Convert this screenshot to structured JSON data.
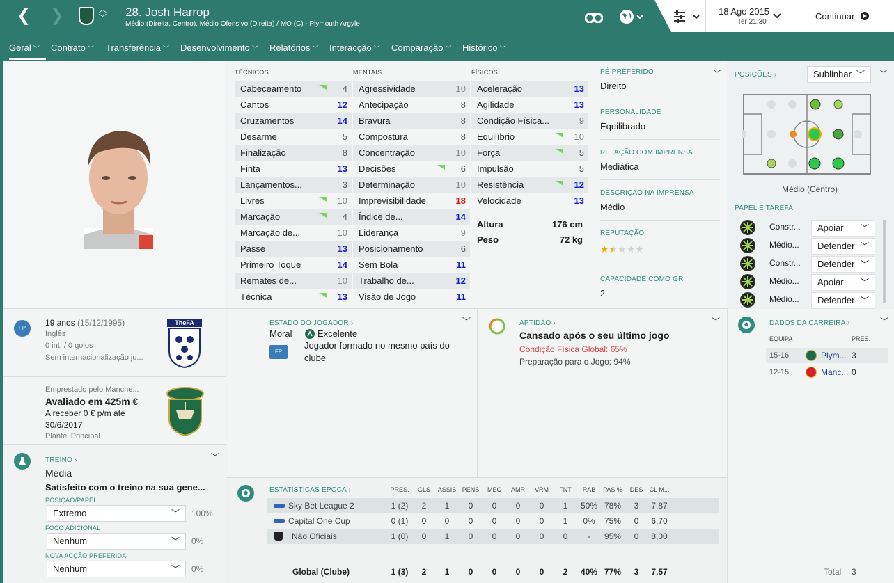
{
  "header": {
    "back": "❮",
    "forward": "❯",
    "title": "28. Josh Harrop",
    "subtitle": "Médio (Direita, Centro), Médio Ofensivo (Direita) / MO (C) - Plymouth Argyle",
    "date": "18 Ago 2015",
    "day_time": "Ter 21:30",
    "continue": "Continuar"
  },
  "nav": [
    "Geral",
    "Contrato",
    "Transferência",
    "Desenvolvimento",
    "Relatórios",
    "Interacção",
    "Comparação",
    "Histórico"
  ],
  "attributes": {
    "technical_header": "TÉCNICOS",
    "mental_header": "MENTAIS",
    "physical_header": "FÍSICOS",
    "technical": [
      [
        "Cabeceamento",
        "4"
      ],
      [
        "Cantos",
        "12"
      ],
      [
        "Cruzamentos",
        "14"
      ],
      [
        "Desarme",
        "5"
      ],
      [
        "Finalização",
        "8"
      ],
      [
        "Finta",
        "13"
      ],
      [
        "Lançamentos...",
        "3"
      ],
      [
        "Livres",
        "10"
      ],
      [
        "Marcação",
        "4"
      ],
      [
        "Marcação de...",
        "10"
      ],
      [
        "Passe",
        "13"
      ],
      [
        "Primeiro Toque",
        "14"
      ],
      [
        "Remates de...",
        "10"
      ],
      [
        "Técnica",
        "13"
      ]
    ],
    "mental": [
      [
        "Agressividade",
        "10"
      ],
      [
        "Antecipação",
        "8"
      ],
      [
        "Bravura",
        "8"
      ],
      [
        "Compostura",
        "8"
      ],
      [
        "Concentração",
        "10"
      ],
      [
        "Decisões",
        "6"
      ],
      [
        "Determinação",
        "10"
      ],
      [
        "Imprevisibilidade",
        "18"
      ],
      [
        "Índice de...",
        "14"
      ],
      [
        "Liderança",
        "9"
      ],
      [
        "Posicionamento",
        "6"
      ],
      [
        "Sem Bola",
        "11"
      ],
      [
        "Trabalho de...",
        "12"
      ],
      [
        "Visão de Jogo",
        "11"
      ]
    ],
    "physical": [
      [
        "Aceleração",
        "13"
      ],
      [
        "Agilidade",
        "13"
      ],
      [
        "Condição Física...",
        "9"
      ],
      [
        "Equilíbrio",
        "10"
      ],
      [
        "Força",
        "5"
      ],
      [
        "Impulsão",
        "5"
      ],
      [
        "Resistência",
        "12"
      ],
      [
        "Velocidade",
        "13"
      ]
    ],
    "height_label": "Altura",
    "height": "176 cm",
    "weight_label": "Peso",
    "weight": "72 kg"
  },
  "profile": {
    "foot_label": "PÉ PREFERIDO",
    "foot": "Direito",
    "pers_label": "PERSONALIDADE",
    "pers": "Equilibrado",
    "media_label": "RELAÇÃO COM IMPRENSA",
    "media": "Mediática",
    "desc_label": "DESCRIÇÃO NA IMPRENSA",
    "desc": "Médio",
    "rep_label": "REPUTAÇÃO",
    "rep_stars": 1.5,
    "gk_label": "CAPACIDADE COMO GR",
    "gk": "2"
  },
  "positions": {
    "label": "POSIÇÕES",
    "select": "Sublinhar",
    "caption": "Médio (Centro)",
    "roles_label": "PAPEL E TAREFA",
    "roles": [
      [
        "Constr...",
        "Apoiar"
      ],
      [
        "Médio...",
        "Defender"
      ],
      [
        "Constr...",
        "Defender"
      ],
      [
        "Médio...",
        "Apoiar"
      ],
      [
        "Médio...",
        "Defender"
      ]
    ]
  },
  "bio": {
    "age": "19 anos",
    "dob": "(15/12/1995)",
    "nation": "Inglês",
    "caps": "0 int. / 0 golos",
    "intl": "Sem internacionalização ju...",
    "fp": "FP",
    "fa": "TheFA"
  },
  "contract": {
    "loan": "Emprestado pelo Manche...",
    "value": "Avaliado em 425m €",
    "wage": "A receber 0 € p/m até",
    "until": "30/6/2017",
    "squad": "Plantel Principal"
  },
  "training": {
    "label": "TREINO",
    "level": "Média",
    "status": "Satisfeito com o treino na sua gene...",
    "pos_label": "POSIÇÃO/PAPEL",
    "pos": "Extremo",
    "pos_pct": "100%",
    "focus_label": "FOCO ADICIONAL",
    "focus": "Nenhum",
    "focus_pct": "0%",
    "move_label": "NOVA ACÇÃO PREFERIDA",
    "move": "Nenhum",
    "move_pct": "0%"
  },
  "status": {
    "label": "ESTADO DO JOGADOR",
    "morale_label": "Moral",
    "morale": "Excelente",
    "fp": "FP",
    "note": "Jogador formado no mesmo país do clube"
  },
  "fitness": {
    "label": "APTIDÃO",
    "title": "Cansado após o seu último jogo",
    "cond": "Condição Física Global: 65%",
    "prep": "Preparação para o Jogo: 94%"
  },
  "career": {
    "label": "DADOS DA CARREIRA",
    "col_team": "EQUIPA",
    "col_apps": "PRES.",
    "rows": [
      [
        "15-16",
        "Plym...",
        "3"
      ],
      [
        "12-15",
        "Manc...",
        "0"
      ]
    ],
    "total_label": "Total",
    "total": "3"
  },
  "season": {
    "label": "ESTATÍSTICAS ÉPOCA",
    "cols": [
      "PRES.",
      "GLS",
      "ASSIS",
      "PENS",
      "MEC",
      "AMR",
      "VRM",
      "FNT",
      "RAB",
      "PAS %",
      "DES",
      "CL M..."
    ],
    "rows": [
      {
        "comp": "Sky Bet League 2",
        "v": [
          "1 (2)",
          "2",
          "1",
          "0",
          "0",
          "0",
          "0",
          "1",
          "50%",
          "78%",
          "3",
          "7,87"
        ]
      },
      {
        "comp": "Capital One Cup",
        "v": [
          "0 (1)",
          "0",
          "0",
          "0",
          "0",
          "0",
          "0",
          "1",
          "0%",
          "75%",
          "0",
          "6,70"
        ]
      },
      {
        "comp": "Não Oficiais",
        "v": [
          "1 (0)",
          "0",
          "1",
          "0",
          "0",
          "0",
          "0",
          "0",
          "-",
          "95%",
          "0",
          "8,00"
        ]
      }
    ],
    "total": {
      "comp": "Global (Clube)",
      "v": [
        "1 (3)",
        "2",
        "1",
        "0",
        "0",
        "0",
        "0",
        "2",
        "40%",
        "77%",
        "3",
        "7,57"
      ]
    }
  },
  "colors": {
    "header": "#2f7a6e",
    "accent": "#2f8c7e",
    "blue_value": "#1422c8",
    "red_value": "#d61414",
    "trend_up": "#7fd168"
  }
}
